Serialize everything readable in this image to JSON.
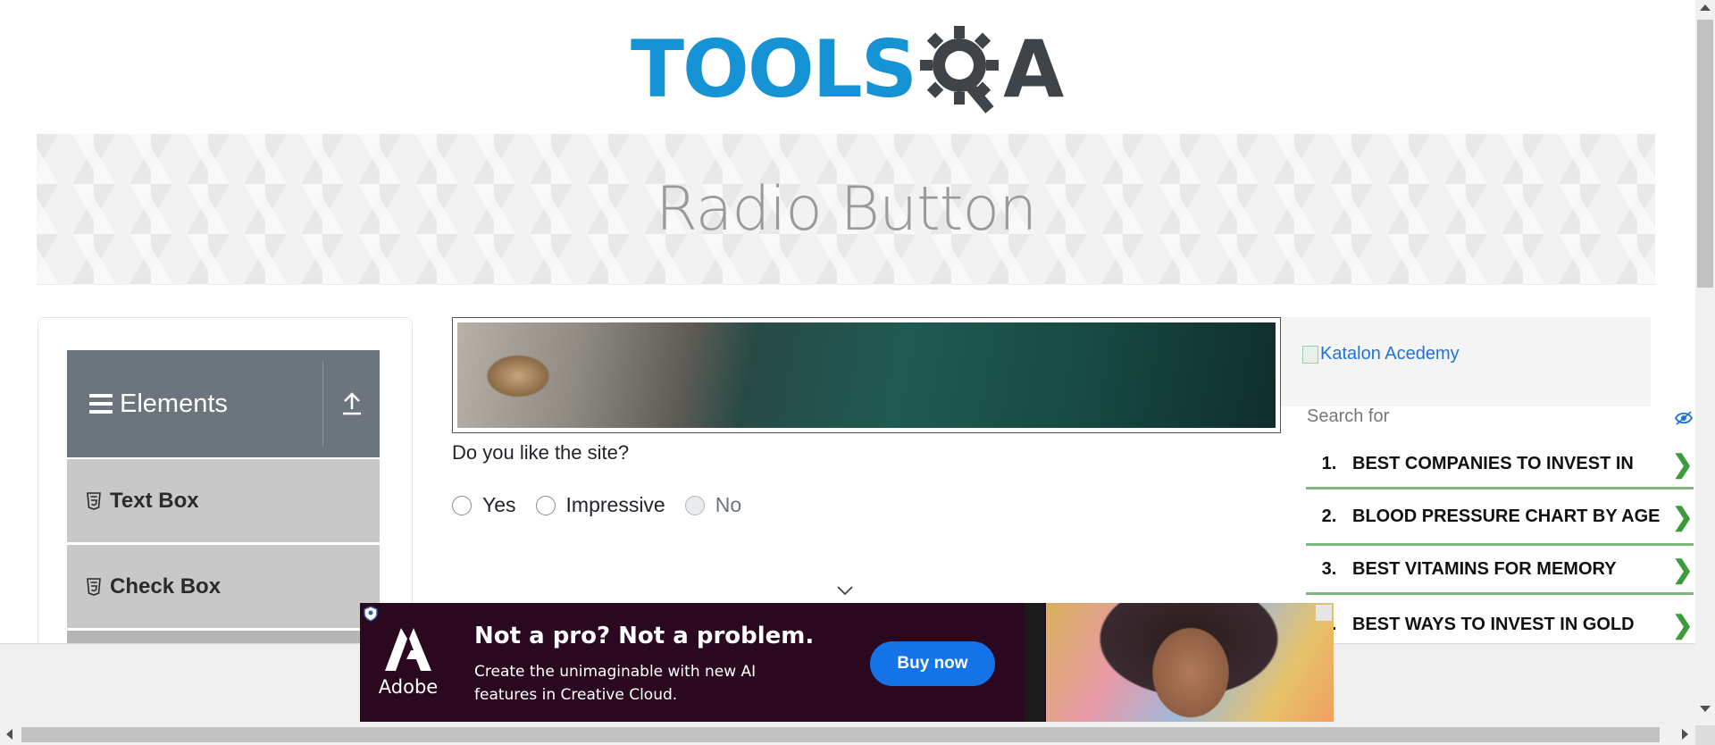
{
  "header": {
    "logo_text_left": "TOOLS",
    "logo_text_right": "A",
    "logo_alt": "ToolsQA"
  },
  "banner": {
    "title": "Radio Button"
  },
  "sidebar": {
    "group_title": "Elements",
    "items": [
      {
        "label": "Text Box"
      },
      {
        "label": "Check Box"
      }
    ]
  },
  "main": {
    "question": "Do you like the site?",
    "options": [
      {
        "label": "Yes",
        "disabled": false
      },
      {
        "label": "Impressive",
        "disabled": false
      },
      {
        "label": "No",
        "disabled": true
      }
    ]
  },
  "right_ad": {
    "image_alt": "Katalon Acedemy",
    "search_label": "Search for",
    "items": [
      {
        "num": "1.",
        "text": "BEST COMPANIES TO INVEST IN"
      },
      {
        "num": "2.",
        "text": "BLOOD PRESSURE CHART BY AGE"
      },
      {
        "num": "3.",
        "text": "BEST VITAMINS FOR MEMORY"
      },
      {
        "num": "4.",
        "text": "BEST WAYS TO INVEST IN GOLD"
      }
    ]
  },
  "bottom_ad": {
    "brand": "Adobe",
    "headline": "Not a pro? Not a problem.",
    "subtext": "Create the unimaginable with new AI features in Creative Cloud.",
    "cta": "Buy now"
  },
  "colors": {
    "brand_blue": "#1593d5",
    "brand_dark": "#3f4449",
    "sidebar_header": "#6c757d",
    "sidebar_item": "#c8c8c8",
    "ad_accent_green": "#7fb87f",
    "adobe_bg": "#2a0920",
    "adobe_button": "#1473e6"
  }
}
